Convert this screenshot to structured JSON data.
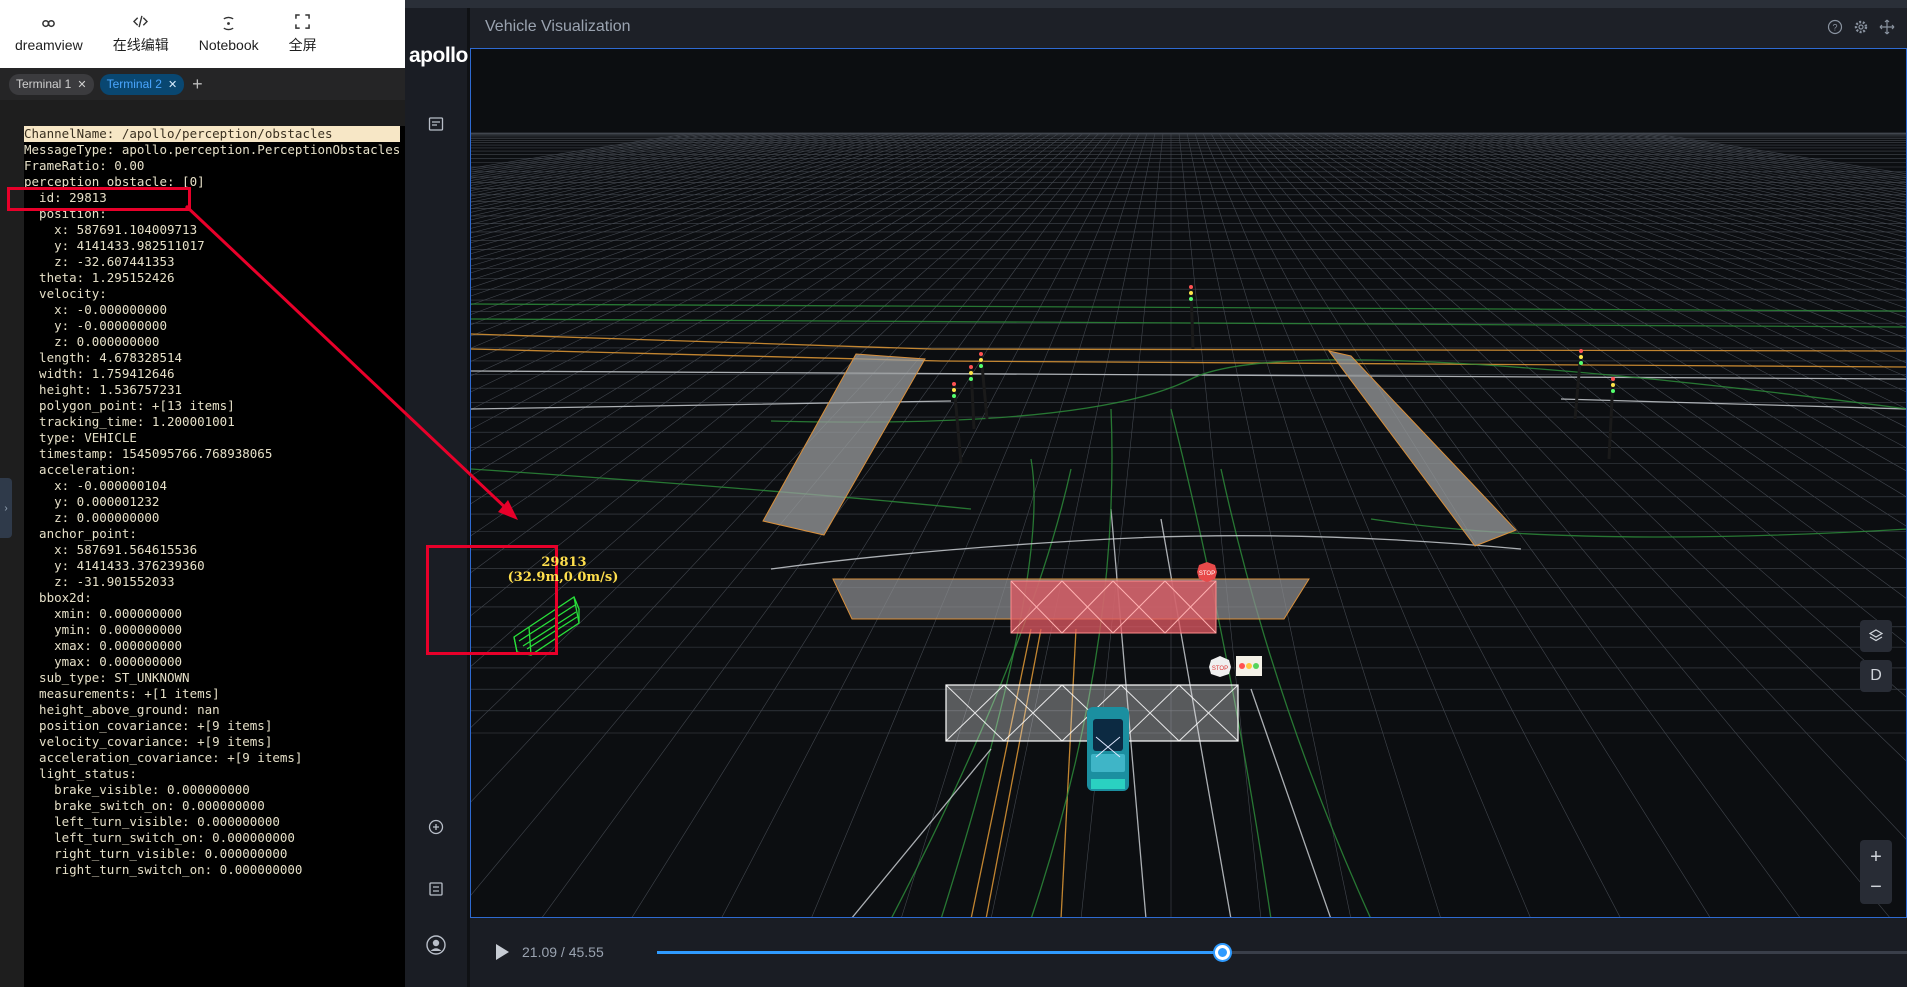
{
  "toolbar": {
    "items": [
      {
        "label": "dreamview",
        "icon": "link-icon"
      },
      {
        "label": "在线编辑",
        "icon": "code-icon"
      },
      {
        "label": "Notebook",
        "icon": "notebook-icon"
      },
      {
        "label": "全屏",
        "icon": "fullscreen-icon"
      }
    ]
  },
  "terminal": {
    "tabs": [
      {
        "label": "Terminal 1",
        "active": false
      },
      {
        "label": "Terminal 2",
        "active": true
      }
    ],
    "add_label": "+",
    "lines": [
      "ChannelName: /apollo/perception/obstacles",
      "MessageType: apollo.perception.PerceptionObstacles",
      "FrameRatio: 0.00",
      "perception_obstacle: [0]",
      "  id: 29813",
      "  position:",
      "    x: 587691.104009713",
      "    y: 4141433.982511017",
      "    z: -32.607441353",
      "  theta: 1.295152426",
      "  velocity:",
      "    x: -0.000000000",
      "    y: -0.000000000",
      "    z: 0.000000000",
      "  length: 4.678328514",
      "  width: 1.759412646",
      "  height: 1.536757231",
      "  polygon_point: +[13 items]",
      "  tracking_time: 1.200001001",
      "  type: VEHICLE",
      "  timestamp: 1545095766.768938065",
      "  acceleration:",
      "    x: -0.000000104",
      "    y: 0.000001232",
      "    z: 0.000000000",
      "  anchor_point:",
      "    x: 587691.564615536",
      "    y: 4141433.376239360",
      "    z: -31.901552033",
      "  bbox2d:",
      "    xmin: 0.000000000",
      "    ymin: 0.000000000",
      "    xmax: 0.000000000",
      "    ymax: 0.000000000",
      "  sub_type: ST_UNKNOWN",
      "  measurements: +[1 items]",
      "  height_above_ground: nan",
      "  position_covariance: +[9 items]",
      "  velocity_covariance: +[9 items]",
      "  acceleration_covariance: +[9 items]",
      "  light_status:",
      "    brake_visible: 0.000000000",
      "    brake_switch_on: 0.000000000",
      "    left_turn_visible: 0.000000000",
      "    left_turn_switch_on: 0.000000000",
      "    right_turn_visible: 0.000000000",
      "    right_turn_switch_on: 0.000000000"
    ]
  },
  "dreamview": {
    "brand": "apollo",
    "panel_title": "Vehicle Visualization",
    "obstacle_label": {
      "id": "29813",
      "info": "(32.9m,0.0m/s)"
    },
    "stop_sign_text": "STOP",
    "view_button": "D",
    "zoom_in": "+",
    "zoom_out": "−",
    "playback": {
      "time": "21.09 / 45.55",
      "progress": 0.4516
    }
  },
  "colors": {
    "accent": "#2f9bff",
    "annotation_red": "#e8002a",
    "label_yellow": "#ffdf4c"
  }
}
